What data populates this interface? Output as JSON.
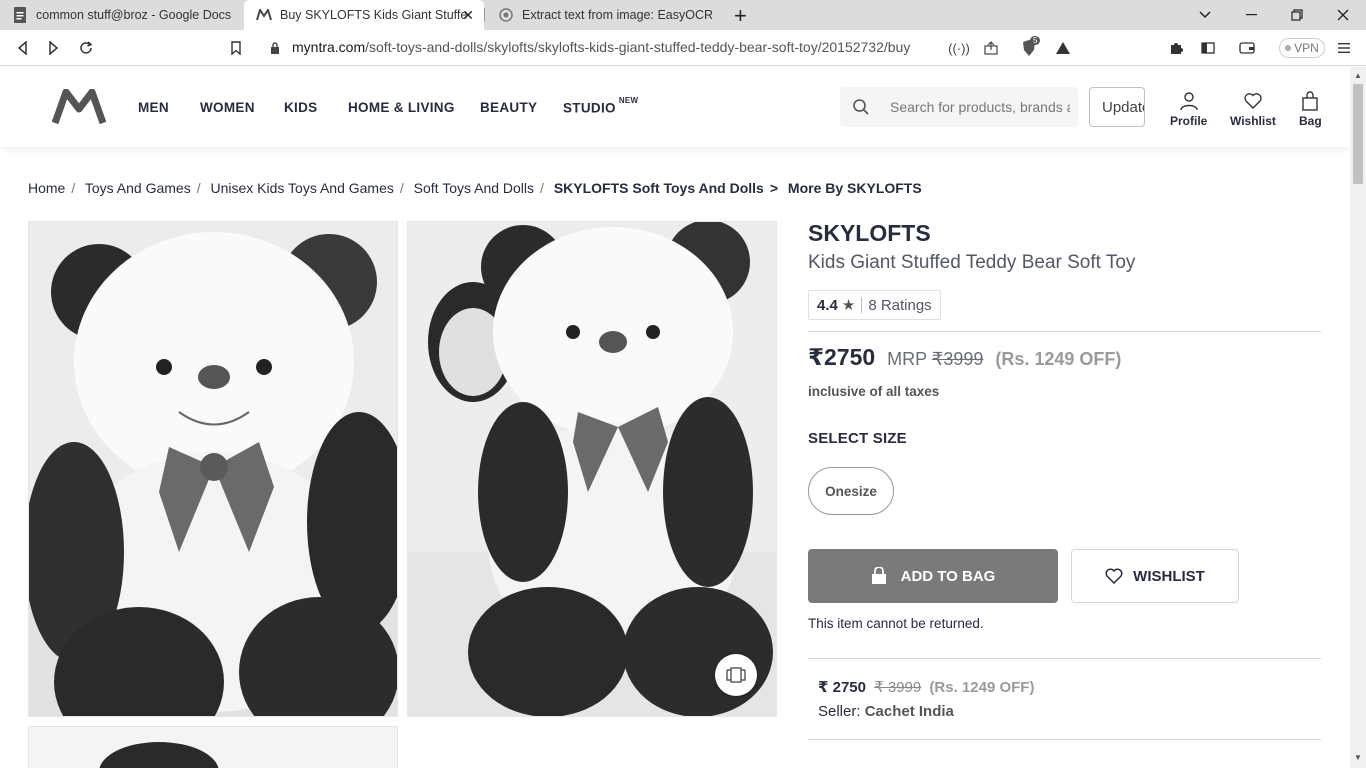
{
  "browser": {
    "tabs": [
      {
        "title": "common stuff@broz - Google Docs",
        "icon": "docs-icon"
      },
      {
        "title": "Buy SKYLOFTS Kids Giant Stuffed",
        "icon": "myntra-icon",
        "active": true
      },
      {
        "title": "Extract text from image: EasyOCR",
        "icon": "easyocr-icon"
      }
    ],
    "url_host": "myntra.com",
    "url_path": "/soft-toys-and-dolls/skylofts/skylofts-kids-giant-stuffed-teddy-bear-soft-toy/20152732/buy",
    "shield_count": "5",
    "vpn_label": "VPN"
  },
  "header": {
    "nav": [
      "MEN",
      "WOMEN",
      "KIDS",
      "HOME & LIVING",
      "BEAUTY",
      "STUDIO"
    ],
    "studio_badge": "NEW",
    "search_placeholder": "Search for products, brands and more",
    "update_label": "Update",
    "actions": {
      "profile": "Profile",
      "wishlist": "Wishlist",
      "bag": "Bag"
    }
  },
  "breadcrumb": {
    "items": [
      "Home",
      "Toys And Games",
      "Unisex Kids Toys And Games",
      "Soft Toys And Dolls",
      "SKYLOFTS Soft Toys And Dolls"
    ],
    "more": "More By SKYLOFTS"
  },
  "product": {
    "brand": "SKYLOFTS",
    "name": "Kids Giant Stuffed Teddy Bear Soft Toy",
    "rating": "4.4",
    "ratings_count": "8 Ratings",
    "price": "₹2750",
    "mrp_label": "MRP",
    "mrp": "₹3999",
    "discount": "(Rs. 1249 OFF)",
    "taxes_note": "inclusive of all taxes",
    "select_size": "SELECT SIZE",
    "size": "Onesize",
    "add_to_bag": "ADD TO BAG",
    "wishlist": "WISHLIST",
    "return_note": "This item cannot be returned.",
    "seller_price": "₹ 2750",
    "seller_mrp": "₹ 3999",
    "seller_discount": "(Rs. 1249 OFF)",
    "seller_label": "Seller:",
    "seller_name": "Cachet India"
  }
}
